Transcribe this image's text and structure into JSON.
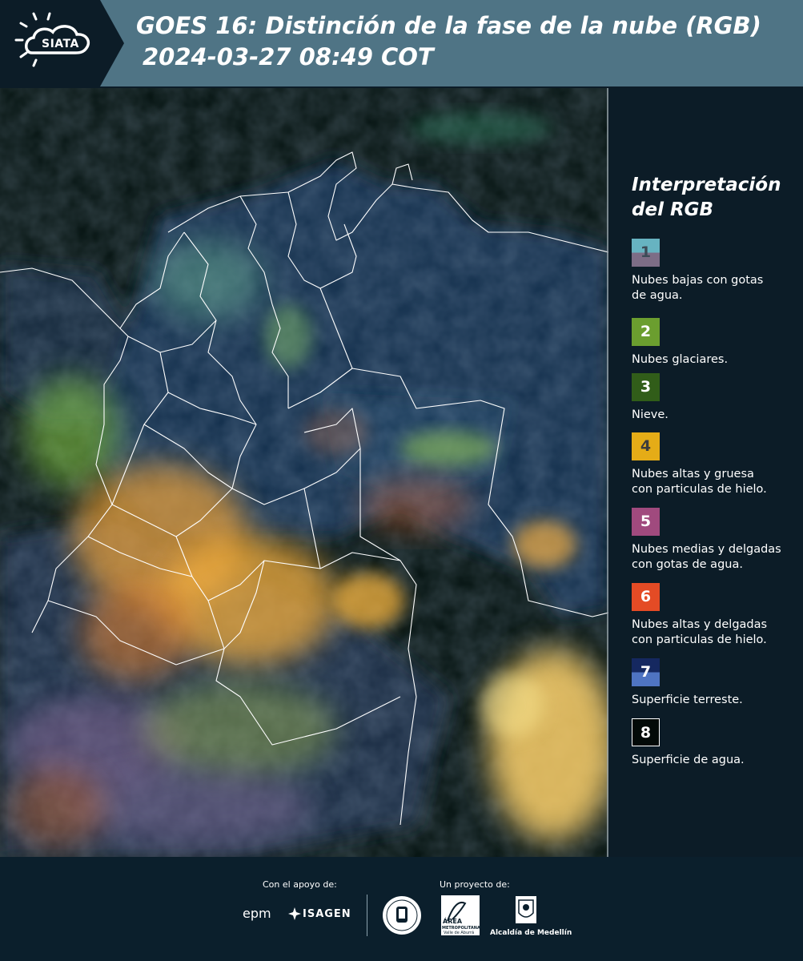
{
  "header": {
    "logo_text": "SIATA",
    "title_line1": "GOES 16: Distinción de la fase de la nube (RGB)",
    "title_line2": "2024-03-27 08:49 COT"
  },
  "legend": {
    "title_line1": "Interpretación",
    "title_line2": "del RGB",
    "items": [
      {
        "num": "1",
        "label_line1": "Nubes bajas con gotas",
        "label_line2": "de agua.",
        "color_top": "#67b3c1",
        "color_bottom": "#7d6d86",
        "num_color": "#3c4b57"
      },
      {
        "num": "2",
        "label_line1": "Nubes glaciares.",
        "label_line2": "",
        "color_top": "#6b9e2f",
        "color_bottom": "#6b9e2f",
        "num_color": "#ffffff"
      },
      {
        "num": "3",
        "label_line1": "Nieve.",
        "label_line2": "",
        "color_top": "#315d19",
        "color_bottom": "#315d19",
        "num_color": "#ffffff"
      },
      {
        "num": "4",
        "label_line1": "Nubes altas y gruesa",
        "label_line2": "con particulas de hielo.",
        "color_top": "#e5ac17",
        "color_bottom": "#e5ac17",
        "num_color": "#3c3c3c"
      },
      {
        "num": "5",
        "label_line1": "Nubes medias y delgadas",
        "label_line2": "con gotas de agua.",
        "color_top": "#a04a7e",
        "color_bottom": "#a04a7e",
        "num_color": "#ffffff"
      },
      {
        "num": "6",
        "label_line1": "Nubes altas y delgadas",
        "label_line2": "con particulas de hielo.",
        "color_top": "#e44b25",
        "color_bottom": "#e44b25",
        "num_color": "#ffffff"
      },
      {
        "num": "7",
        "label_line1": "Superficie terreste.",
        "label_line2": "",
        "color_top": "#152860",
        "color_bottom": "#4f74c2",
        "num_color": "#ffffff"
      },
      {
        "num": "8",
        "label_line1": "Superficie de agua.",
        "label_line2": "",
        "color_top": "#030a08",
        "color_bottom": "#030a08",
        "num_color": "#ffffff"
      }
    ]
  },
  "footer": {
    "support_label": "Con el apoyo de:",
    "project_label": "Un proyecto de:",
    "sponsor1": "epm",
    "sponsor2": "ISAGEN",
    "partner1_line1": "ÁREA",
    "partner1_line2": "METROPOLITANA",
    "partner1_line3": "Valle de Aburrá",
    "partner2": "Alcaldía de Medellín"
  }
}
